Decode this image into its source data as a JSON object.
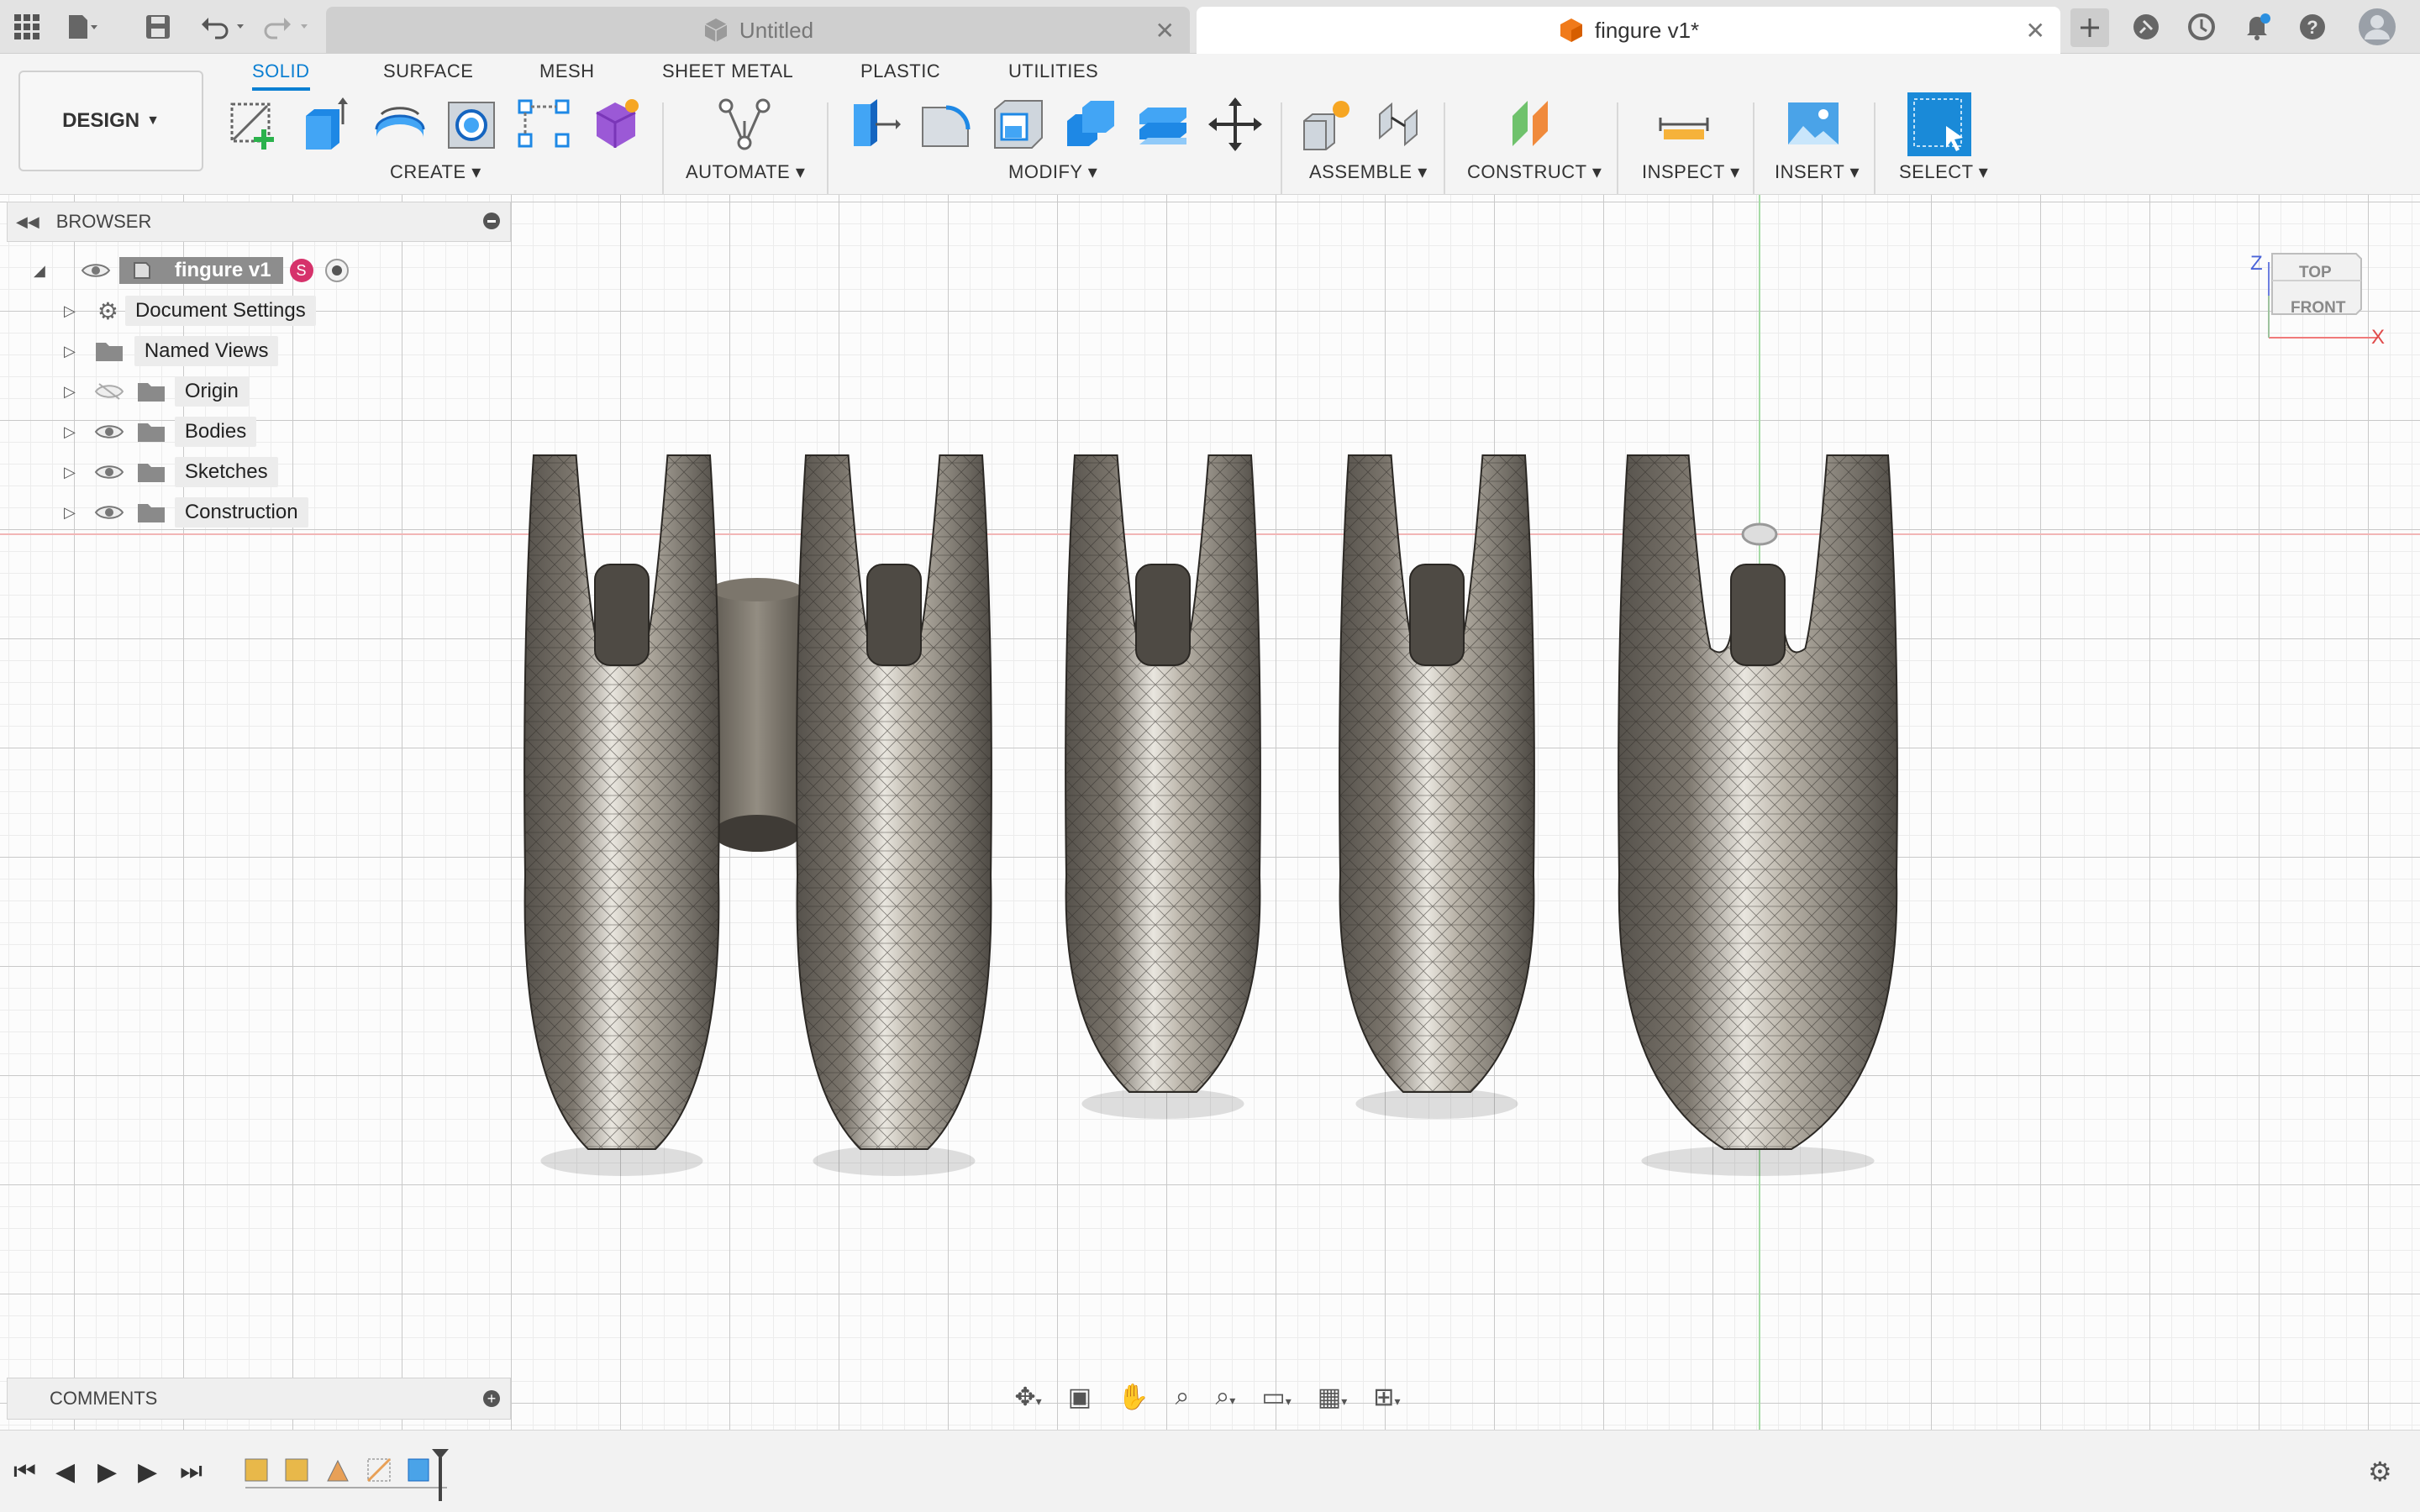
{
  "tabs": {
    "inactive_title": "Untitled",
    "active_title": "fingure v1*"
  },
  "ribbon": {
    "tabs": [
      "SOLID",
      "SURFACE",
      "MESH",
      "SHEET METAL",
      "PLASTIC",
      "UTILITIES"
    ],
    "workspace": "DESIGN",
    "groups": {
      "create": "CREATE",
      "automate": "AUTOMATE",
      "modify": "MODIFY",
      "assemble": "ASSEMBLE",
      "construct": "CONSTRUCT",
      "inspect": "INSPECT",
      "insert": "INSERT",
      "select": "SELECT"
    },
    "accent": "#0b7fd2"
  },
  "browser": {
    "title": "BROWSER",
    "root": "fingure v1",
    "items": [
      "Document Settings",
      "Named Views",
      "Origin",
      "Bodies",
      "Sketches",
      "Construction"
    ]
  },
  "viewcube": {
    "top": "TOP",
    "front": "FRONT",
    "z_axis": "Z",
    "x_axis": "X"
  },
  "comments": {
    "title": "COMMENTS"
  },
  "icons": [
    "apps-grid-icon",
    "file-icon",
    "save-icon",
    "undo-icon",
    "redo-icon",
    "add-tab-icon",
    "extensions-icon",
    "job-status-icon",
    "notifications-icon",
    "help-icon",
    "user-avatar-icon",
    "settings-gear-icon"
  ],
  "colors": {
    "mesh_body": "#6f6a62",
    "mesh_highlight": "#f2f0ea",
    "grid_major": "#c9c9c9",
    "grid_minor": "#ececec",
    "x_axis_line": "#f2b6b6",
    "y_axis_line": "#a6dba6"
  }
}
